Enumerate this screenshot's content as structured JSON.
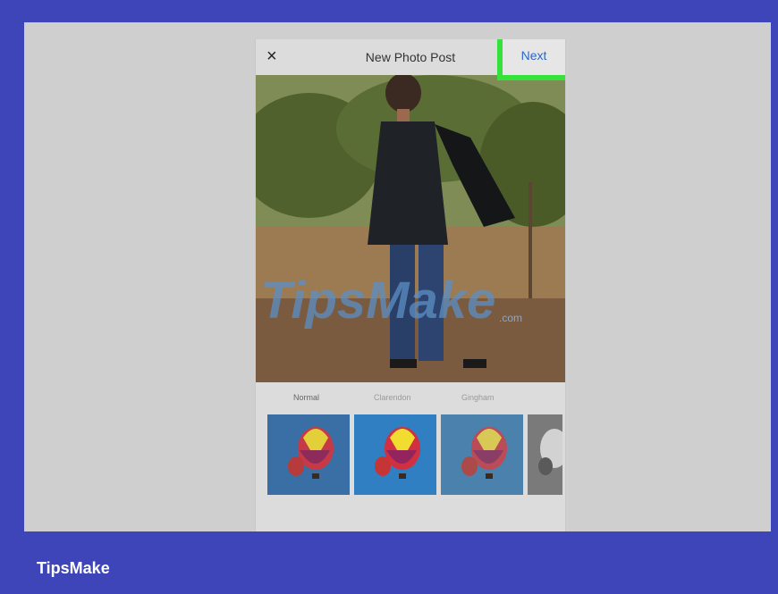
{
  "dialog": {
    "title": "New Photo Post",
    "close_label": "×",
    "next_label": "Next"
  },
  "photo": {
    "watermark": "TipsMake",
    "watermark_suffix": ".com"
  },
  "filters": [
    {
      "label": "Normal"
    },
    {
      "label": "Clarendon"
    },
    {
      "label": "Gingham"
    }
  ],
  "brand": {
    "name": "TipsMake"
  },
  "colors": {
    "frame_blue": "#3d45b8",
    "highlight_green": "#35e23c",
    "link_blue": "#2a66c9"
  }
}
